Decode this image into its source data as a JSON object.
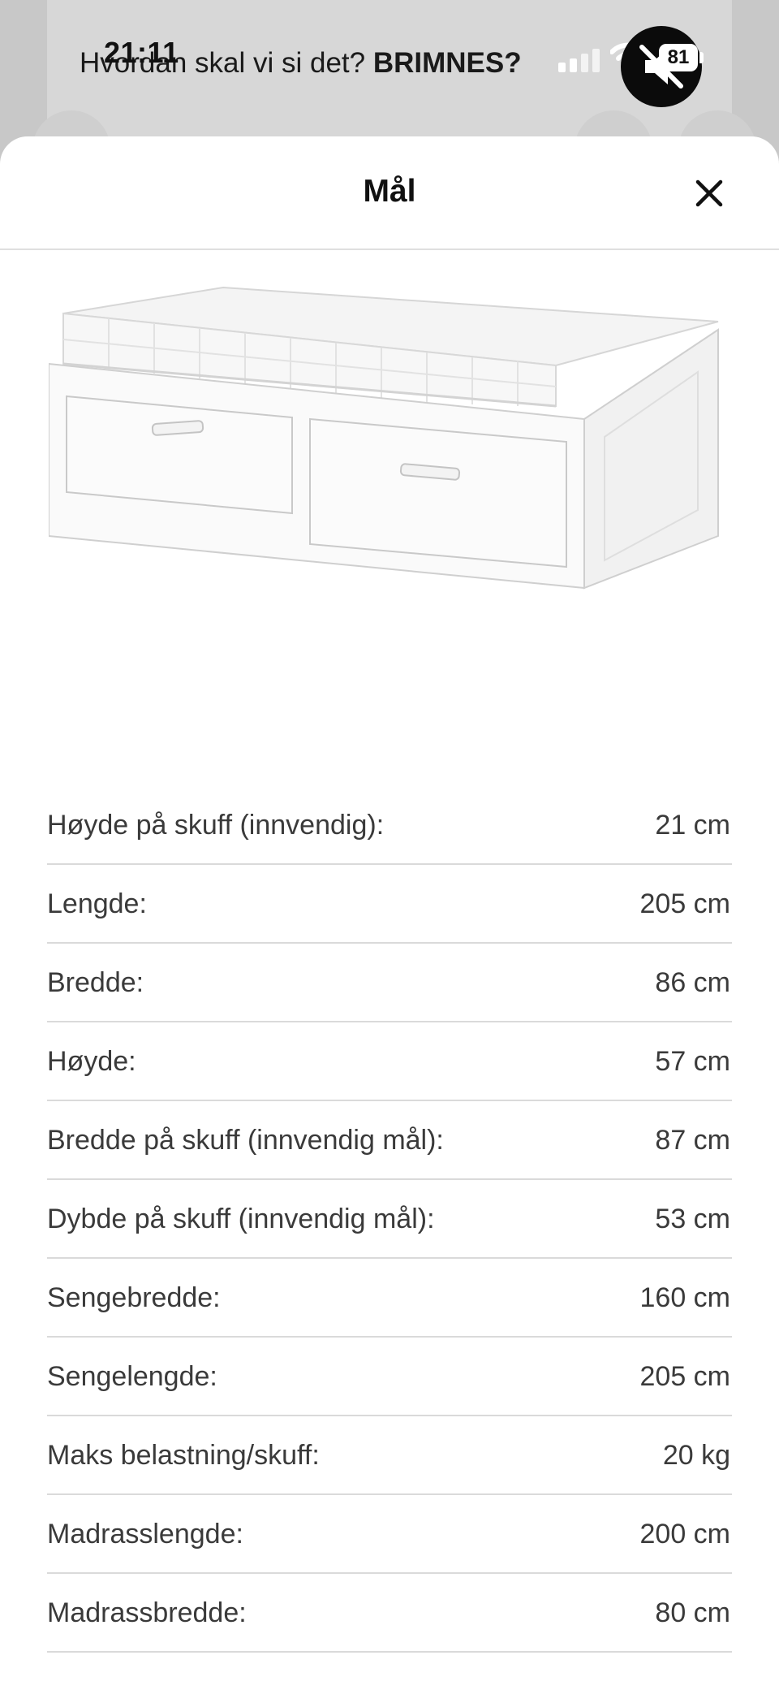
{
  "background": {
    "title_prefix": "Hvordan skal vi si det?",
    "title_emphasis": "BRIMNES?"
  },
  "status_bar": {
    "time": "21:11",
    "battery": "81",
    "icons": [
      "signal-icon",
      "wifi-icon",
      "mute-icon",
      "battery-icon"
    ]
  },
  "sheet": {
    "title": "Mål",
    "close_icon": "close-icon",
    "image_alt": "BRIMNES daybed with two drawers and mattresses",
    "rows": [
      {
        "label": "Høyde på skuff (innvendig):",
        "value": "21 cm"
      },
      {
        "label": "Lengde:",
        "value": "205 cm"
      },
      {
        "label": "Bredde:",
        "value": "86 cm"
      },
      {
        "label": "Høyde:",
        "value": "57 cm"
      },
      {
        "label": "Bredde på skuff (innvendig mål):",
        "value": "87 cm"
      },
      {
        "label": "Dybde på skuff (innvendig mål):",
        "value": "53 cm"
      },
      {
        "label": "Sengebredde:",
        "value": "160 cm"
      },
      {
        "label": "Sengelengde:",
        "value": "205 cm"
      },
      {
        "label": "Maks belastning/skuff:",
        "value": "20 kg"
      },
      {
        "label": "Madrasslengde:",
        "value": "200 cm"
      },
      {
        "label": "Madrassbredde:",
        "value": "80 cm"
      }
    ]
  },
  "colors": {
    "overlay": "#c9c9c9",
    "sheet": "#ffffff",
    "divider": "#dadada",
    "text": "#3a3a3a"
  }
}
